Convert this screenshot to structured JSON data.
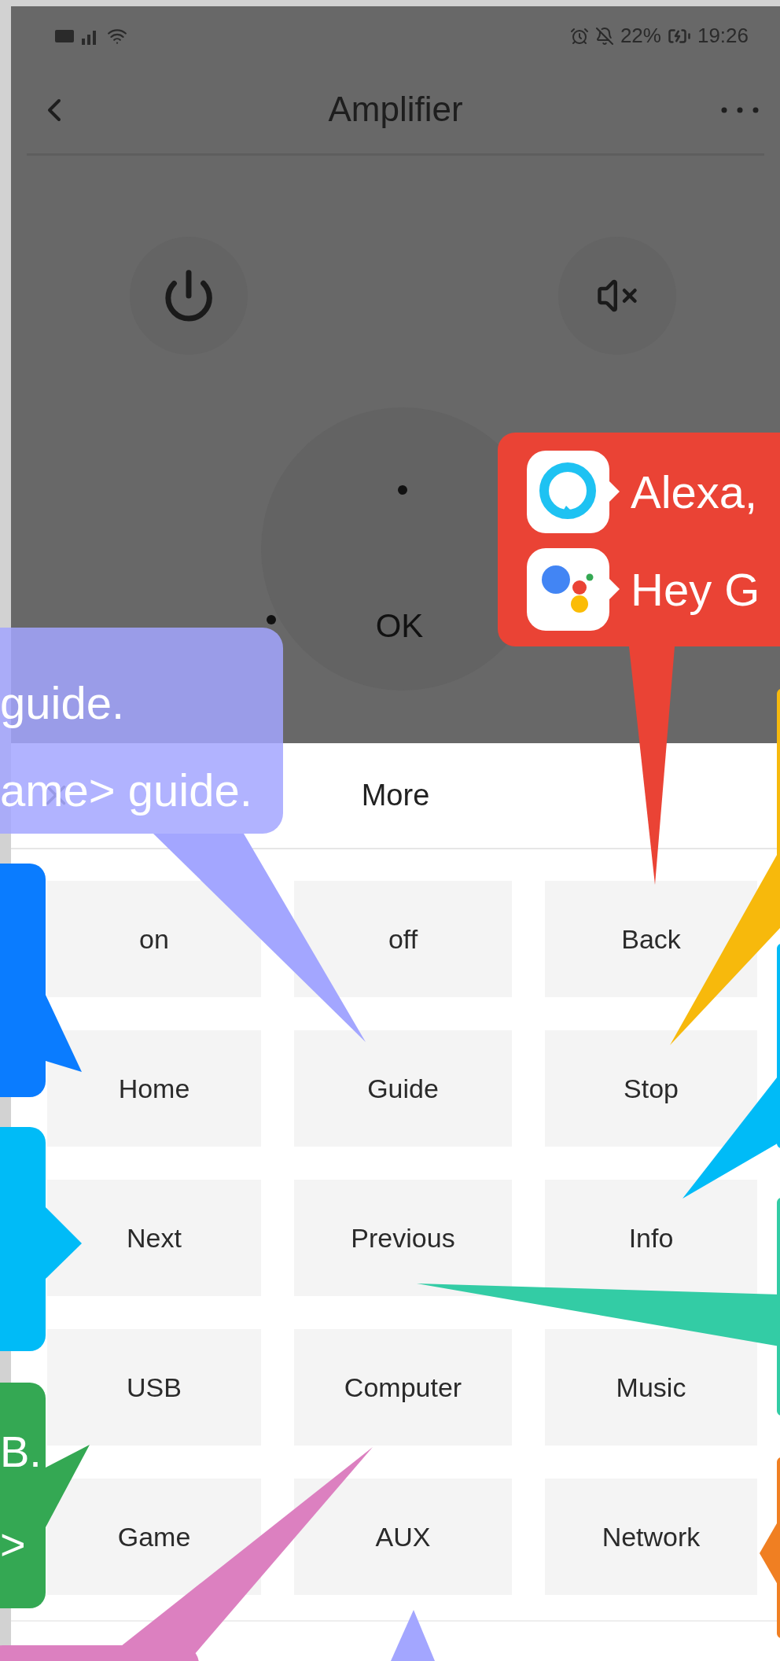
{
  "status_bar": {
    "battery": "22%",
    "time": "19:26"
  },
  "header": {
    "title": "Amplifier"
  },
  "remote": {
    "ok_label": "OK"
  },
  "sheet": {
    "title": "More",
    "buttons": [
      "on",
      "off",
      "Back",
      "Home",
      "Guide",
      "Stop",
      "Next",
      "Previous",
      "Info",
      "USB",
      "Computer",
      "Music",
      "Game",
      "AUX",
      "Network"
    ]
  },
  "callouts": [
    {
      "color": "#ea4335",
      "lines": [
        "Alexa,",
        "Hey G"
      ]
    },
    {
      "color": "#a3a6ff",
      "lines": [
        "guide.",
        "ame> guide."
      ]
    },
    {
      "color": "#f7b90c"
    },
    {
      "color": "#0a7cff"
    },
    {
      "color": "#00bbf7"
    },
    {
      "color": "#00bbf7"
    },
    {
      "color": "#33cca5"
    },
    {
      "color": "#34a853",
      "lines": [
        "B.",
        ">"
      ]
    },
    {
      "color": "#f07f22"
    },
    {
      "color": "#dc80c0"
    },
    {
      "color": "#a3a6ff"
    }
  ]
}
